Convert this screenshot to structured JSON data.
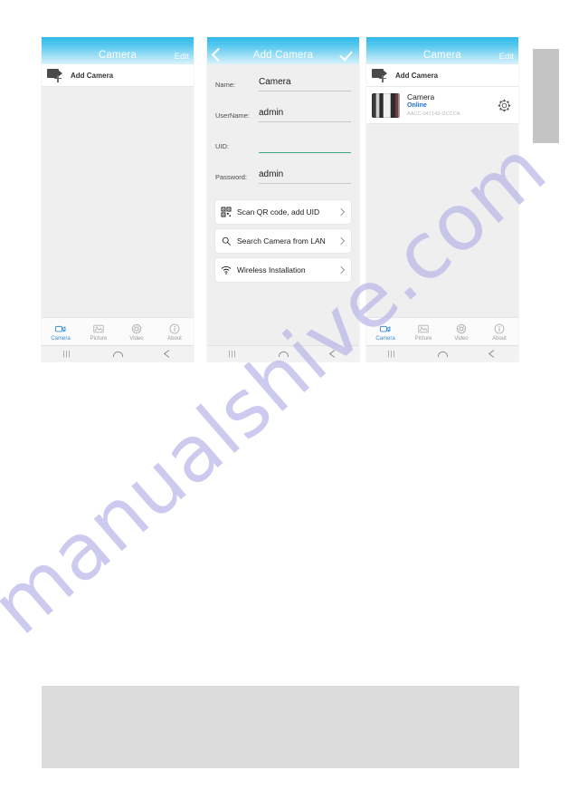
{
  "page": {
    "watermark": "manualshive.com"
  },
  "screens": [
    {
      "id": "camera-list-empty",
      "nav": {
        "title": "Camera",
        "right_action": "Edit",
        "back_icon": "chevron-left-icon",
        "confirm_icon": "check-icon"
      },
      "add_row": {
        "icon": "video-camera-plus-icon",
        "label": "Add Camera"
      },
      "cameras": [],
      "tabs": [
        {
          "label": "Camera",
          "icon": "video-camera-icon",
          "active": true
        },
        {
          "label": "Picture",
          "icon": "picture-icon",
          "active": false
        },
        {
          "label": "Video",
          "icon": "video-reel-icon",
          "active": false
        },
        {
          "label": "About",
          "icon": "info-icon",
          "active": false
        }
      ],
      "system_bar": {
        "recents_icon": "recents-icon",
        "home_icon": "home-icon",
        "back_icon": "back-icon"
      }
    },
    {
      "id": "add-camera-form",
      "nav": {
        "title": "Add Camera",
        "right_action": "",
        "back_icon": "chevron-left-icon",
        "confirm_icon": "check-icon"
      },
      "form": [
        {
          "label": "Name:",
          "value": "Camera",
          "placeholder": "",
          "focused": false
        },
        {
          "label": "UserName:",
          "value": "admin",
          "placeholder": "",
          "focused": false
        },
        {
          "label": "UID:",
          "value": "",
          "placeholder": "",
          "focused": true
        },
        {
          "label": "Password:",
          "value": "admin",
          "placeholder": "",
          "focused": false
        }
      ],
      "actions": [
        {
          "label": "Scan QR code, add UID",
          "icon": "qr-code-icon",
          "chevron": "chevron-right-icon"
        },
        {
          "label": "Search Camera from LAN",
          "icon": "search-icon",
          "chevron": "chevron-right-icon"
        },
        {
          "label": "Wireless Installation",
          "icon": "wifi-icon",
          "chevron": "chevron-right-icon"
        }
      ],
      "system_bar": {
        "recents_icon": "recents-icon",
        "home_icon": "home-icon",
        "back_icon": "back-icon"
      }
    },
    {
      "id": "camera-list-added",
      "nav": {
        "title": "Camera",
        "right_action": "Edit",
        "back_icon": "chevron-left-icon",
        "confirm_icon": "check-icon"
      },
      "add_row": {
        "icon": "video-camera-plus-icon",
        "label": "Add Camera"
      },
      "cameras": [
        {
          "name": "Camera",
          "status": "Online",
          "uid": "AACC-047149-DCCCA",
          "settings_icon": "gear-icon",
          "thumbnail": "camera-snapshot"
        }
      ],
      "tabs": [
        {
          "label": "Camera",
          "icon": "video-camera-icon",
          "active": true
        },
        {
          "label": "Picture",
          "icon": "picture-icon",
          "active": false
        },
        {
          "label": "Video",
          "icon": "video-reel-icon",
          "active": false
        },
        {
          "label": "About",
          "icon": "info-icon",
          "active": false
        }
      ],
      "system_bar": {
        "recents_icon": "recents-icon",
        "home_icon": "home-icon",
        "back_icon": "back-icon"
      }
    }
  ],
  "colors": {
    "nav_gradient_start": "#2fb9e8",
    "nav_gradient_end": "#d9f2fb",
    "status_online": "#1f6fd0",
    "tab_active": "#3d8fd6",
    "field_focus": "#3ba882",
    "screen_bg": "#efefef",
    "watermark": "#b9b7e8"
  }
}
